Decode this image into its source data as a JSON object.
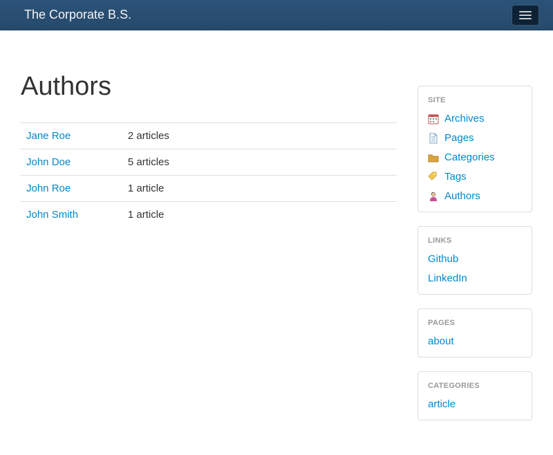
{
  "navbar": {
    "brand": "The Corporate B.S."
  },
  "page": {
    "title": "Authors"
  },
  "authors": [
    {
      "name": "Jane Roe",
      "count": "2 articles"
    },
    {
      "name": "John Doe",
      "count": "5 articles"
    },
    {
      "name": "John Roe",
      "count": "1 article"
    },
    {
      "name": "John Smith",
      "count": "1 article"
    }
  ],
  "sidebar": {
    "site": {
      "title": "SITE",
      "items": [
        {
          "label": "Archives",
          "icon": "calendar-icon"
        },
        {
          "label": "Pages",
          "icon": "page-icon"
        },
        {
          "label": "Categories",
          "icon": "folder-icon"
        },
        {
          "label": "Tags",
          "icon": "tag-icon"
        },
        {
          "label": "Authors",
          "icon": "person-icon"
        }
      ]
    },
    "links": {
      "title": "LINKS",
      "items": [
        {
          "label": "Github"
        },
        {
          "label": "LinkedIn"
        }
      ]
    },
    "pages": {
      "title": "PAGES",
      "items": [
        {
          "label": "about"
        }
      ]
    },
    "categories": {
      "title": "CATEGORIES",
      "items": [
        {
          "label": "article"
        }
      ]
    }
  }
}
